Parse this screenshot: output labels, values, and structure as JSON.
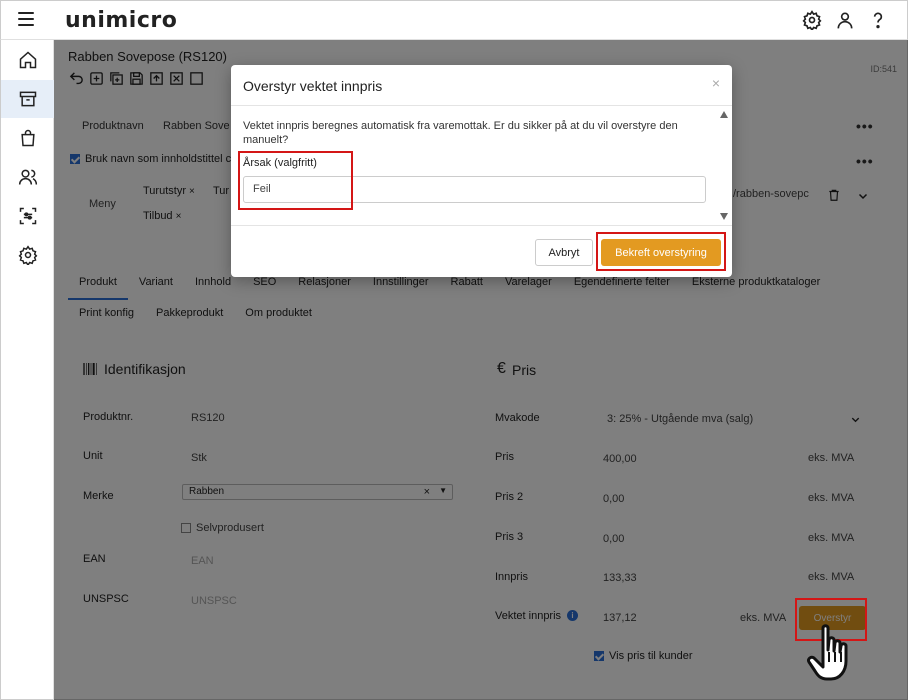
{
  "app": {
    "logo": "unimicro"
  },
  "product": {
    "title": "Rabben Sovepose (RS120)",
    "id_label": "ID:541"
  },
  "top_section": {
    "field_productname": "Produktnavn",
    "field_value_partial": "Rabben Sove",
    "checkbox_label_partial": "Bruk navn som innholdstittel c",
    "menu_label": "Meny",
    "tags": [
      "Turutstyr",
      "Tur",
      "Tilbud"
    ],
    "tag_remove": "×",
    "url_partial": "/rabben-sovepc"
  },
  "tabs": [
    "Produkt",
    "Variant",
    "Innhold",
    "SEO",
    "Relasjoner",
    "Innstillinger",
    "Rabatt",
    "Varelager",
    "Egendefinerte felter",
    "Eksterne produktkataloger"
  ],
  "tabs2": [
    "Print konfig",
    "Pakkeprodukt",
    "Om produktet"
  ],
  "identification": {
    "title": "Identifikasjon",
    "rows": [
      {
        "label": "Produktnr.",
        "value": "RS120"
      },
      {
        "label": "Unit",
        "value": "Stk"
      },
      {
        "label": "Merke",
        "value": "Rabben"
      },
      {
        "label": "EAN",
        "value": "EAN"
      },
      {
        "label": "UNSPSC",
        "value": "UNSPSC"
      }
    ],
    "selvprodusert": "Selvprodusert",
    "select_clear": "×"
  },
  "price": {
    "title": "Pris",
    "currency_symbol": "€",
    "mvakode_label": "Mvakode",
    "mvakode_value": "3: 25% - Utgående mva (salg)",
    "rows": [
      {
        "label": "Pris",
        "value": "400,00",
        "suffix": "eks. MVA"
      },
      {
        "label": "Pris 2",
        "value": "0,00",
        "suffix": "eks. MVA"
      },
      {
        "label": "Pris 3",
        "value": "0,00",
        "suffix": "eks. MVA"
      },
      {
        "label": "Innpris",
        "value": "133,33",
        "suffix": "eks. MVA"
      }
    ],
    "weighted_label": "Vektet innpris",
    "weighted_value": "137,12",
    "weighted_suffix": "eks. MVA",
    "override_button": "Overstyr",
    "show_price_label": "Vis pris til kunder"
  },
  "modal": {
    "title": "Overstyr vektet innpris",
    "close": "×",
    "text": "Vektet innpris beregnes automatisk fra varemottak. Er du sikker på at du vil overstyre den manuelt?",
    "reason_label": "Årsak (valgfritt)",
    "reason_value": "Feil",
    "cancel_button": "Avbryt",
    "confirm_button": "Bekreft overstyring"
  },
  "colors": {
    "accent": "#e39a21",
    "primary": "#2a6fd6",
    "highlight": "#d41616"
  }
}
